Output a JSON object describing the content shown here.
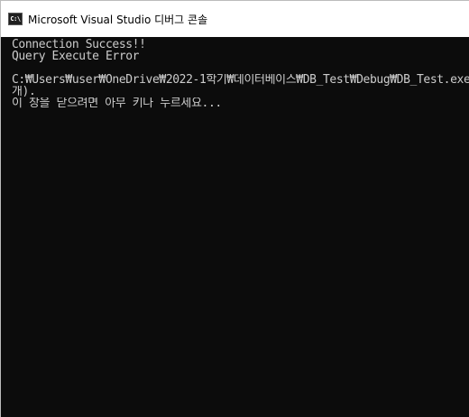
{
  "window": {
    "title": "Microsoft Visual Studio 디버그 콘솔",
    "icon_name": "console-app-icon",
    "icon_text": "C:\\"
  },
  "console": {
    "lines": [
      "Connection Success!!",
      "Query Execute Error",
      "",
      "C:₩Users₩user₩OneDrive₩2022-1학기₩데이터베이스₩DB_Test₩Debug₩DB_Test.exe",
      "개).",
      "이 창을 닫으려면 아무 키나 누르세요..."
    ]
  },
  "colors": {
    "console_background": "#0c0c0c",
    "console_text": "#cccccc",
    "titlebar_background": "#ffffff"
  }
}
